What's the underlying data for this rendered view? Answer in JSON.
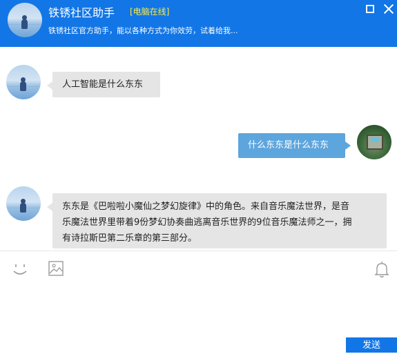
{
  "header": {
    "title": "铁锈社区助手",
    "status": "[电脑在线]",
    "subtitle": "铁锈社区官方助手，能以各种方式为你效劳，试着给我..."
  },
  "messages": [
    {
      "side": "left",
      "text": "人工智能是什么东东"
    },
    {
      "side": "right",
      "text": "什么东东是什么东东"
    },
    {
      "side": "left",
      "lines": [
        "东东是《巴啦啦小魔仙之梦幻旋律》中的角色。来自音乐魔法世界，是音",
        "乐魔法世界里带着9份梦幻协奏曲逃离音乐世界的9位音乐魔法师之一，拥",
        "有诗拉斯巴第二乐章的第三部分。"
      ]
    }
  ],
  "toolbar": {
    "icons": [
      "emoji-icon",
      "image-icon",
      "bell-icon"
    ]
  },
  "send_label": "发送",
  "colors": {
    "header_bg": "#1276e6",
    "status_text": "#ffec3d",
    "incoming_bubble": "#e5e5e5",
    "outgoing_bubble": "#5da5dd",
    "send_button": "#1276e6"
  }
}
